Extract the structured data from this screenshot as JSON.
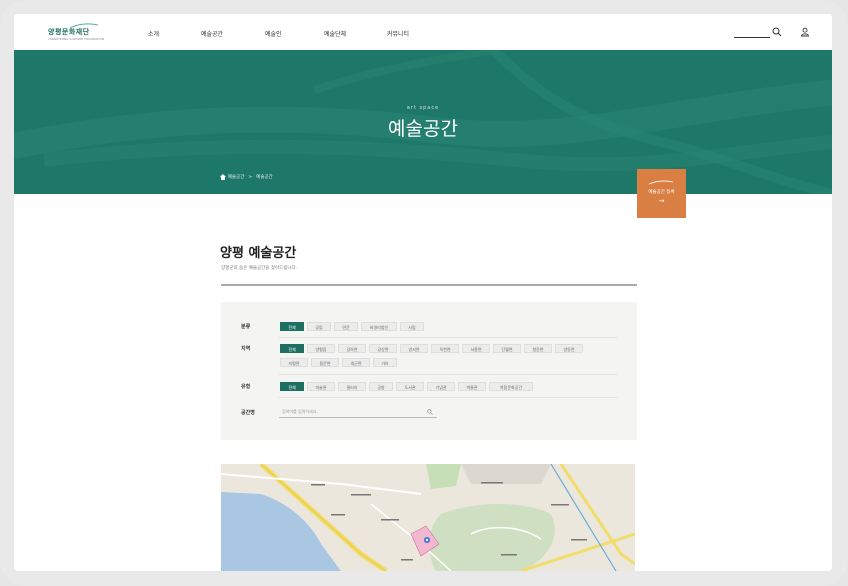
{
  "header": {
    "logo_text": "양평문화재단",
    "logo_sub": "YANGPYEONG CULTURE FOUNDATION",
    "nav": [
      "소개",
      "예술공간",
      "예술인",
      "예술단체",
      "커뮤니티"
    ]
  },
  "hero": {
    "kicker": "art space",
    "title": "예술공간",
    "breadcrumb": [
      "예술공간",
      "예술공간"
    ]
  },
  "register_button": {
    "label": "예술공간 등록",
    "arrow": "→"
  },
  "section": {
    "title": "양평 예술공간",
    "description": "양평군의 숨은 예술공간을 찾아드립니다."
  },
  "filters": {
    "category": {
      "label": "분류",
      "options": [
        "전체",
        "공립",
        "민간",
        "비영리법인",
        "사립"
      ]
    },
    "region": {
      "label": "지역",
      "options": [
        "전체",
        "양평읍",
        "강하면",
        "강상면",
        "양서면",
        "옥천면",
        "서종면",
        "단월면",
        "청운면",
        "양동면",
        "지평면",
        "용문면",
        "개군면",
        "기타"
      ]
    },
    "type": {
      "label": "유형",
      "options": [
        "전체",
        "미술관",
        "갤러리",
        "공방",
        "도서관",
        "기념관",
        "박물관",
        "복합문화공간"
      ]
    },
    "space_name": {
      "label": "공간명",
      "placeholder": "검색어를 입력하세요."
    }
  },
  "colors": {
    "primary": "#1e7869",
    "accent": "#d97f44"
  }
}
